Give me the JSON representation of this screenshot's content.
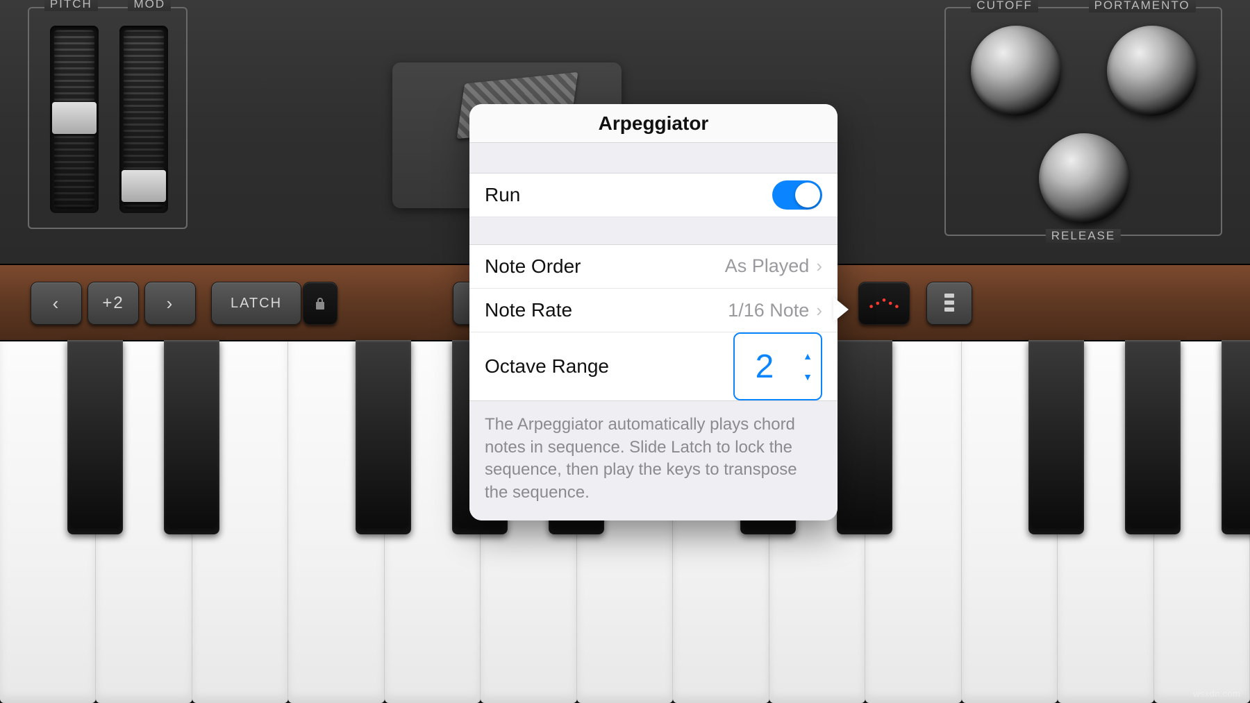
{
  "synth": {
    "wheels": {
      "pitch_label": "PITCH",
      "mod_label": "MOD"
    },
    "knobs": {
      "cutoff_label": "CUTOFF",
      "portamento_label": "PORTAMENTO",
      "release_label": "RELEASE"
    }
  },
  "toolbar": {
    "octave_value": "+2",
    "latch_label": "LATCH"
  },
  "popover": {
    "title": "Arpeggiator",
    "run": {
      "label": "Run",
      "on": true
    },
    "note_order": {
      "label": "Note Order",
      "value": "As Played"
    },
    "note_rate": {
      "label": "Note Rate",
      "value": "1/16 Note"
    },
    "octave_range": {
      "label": "Octave Range",
      "value": "2"
    },
    "description": "The Arpeggiator automatically plays chord notes in sequence. Slide Latch to lock the sequence, then play the keys to transpose the sequence."
  },
  "watermark": "wsxdn.com"
}
